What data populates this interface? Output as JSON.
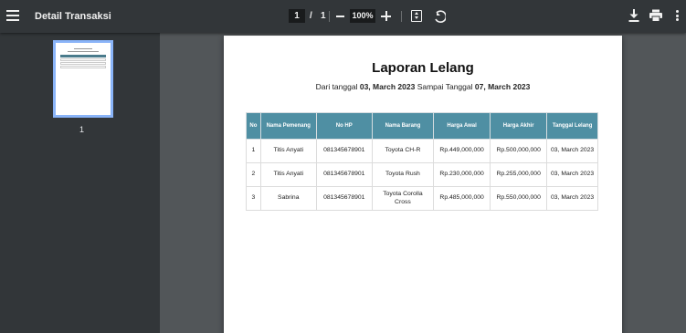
{
  "toolbar": {
    "title": "Detail Transaksi",
    "current_page": "1",
    "page_separator": "/",
    "total_pages": "1",
    "zoom": "100%"
  },
  "sidebar": {
    "thumbnail_page_number": "1"
  },
  "report": {
    "title": "Laporan Lelang",
    "subtitle_prefix": "Dari tanggal",
    "date_from": "03, March 2023",
    "subtitle_middle": "Sampai Tanggal",
    "date_to": "07, March 2023",
    "columns": [
      "No",
      "Nama Pemenang",
      "No HP",
      "Nama Barang",
      "Harga Awal",
      "Harga Akhir",
      "Tanggal Lelang"
    ],
    "rows": [
      [
        "1",
        "Titis Anyati",
        "081345678901",
        "Toyota CH-R",
        "Rp.449,000,000",
        "Rp.500,000,000",
        "03, March 2023"
      ],
      [
        "2",
        "Titis Anyati",
        "081345678901",
        "Toyota Rush",
        "Rp.230,000,000",
        "Rp.255,000,000",
        "03, March 2023"
      ],
      [
        "3",
        "Sabrina",
        "081345678901",
        "Toyota Corolla Cross",
        "Rp.485,000,000",
        "Rp.550,000,000",
        "03, March 2023"
      ]
    ]
  },
  "colors": {
    "toolbar_bg": "#323639",
    "viewer_bg": "#525659",
    "table_header_bg": "#4f8fa3",
    "thumbnail_selected_border": "#8ab4f8"
  },
  "icons": [
    "menu-icon",
    "zoom-out-icon",
    "zoom-in-icon",
    "fit-to-page-icon",
    "rotate-icon",
    "download-icon",
    "print-icon",
    "more-vert-icon"
  ]
}
